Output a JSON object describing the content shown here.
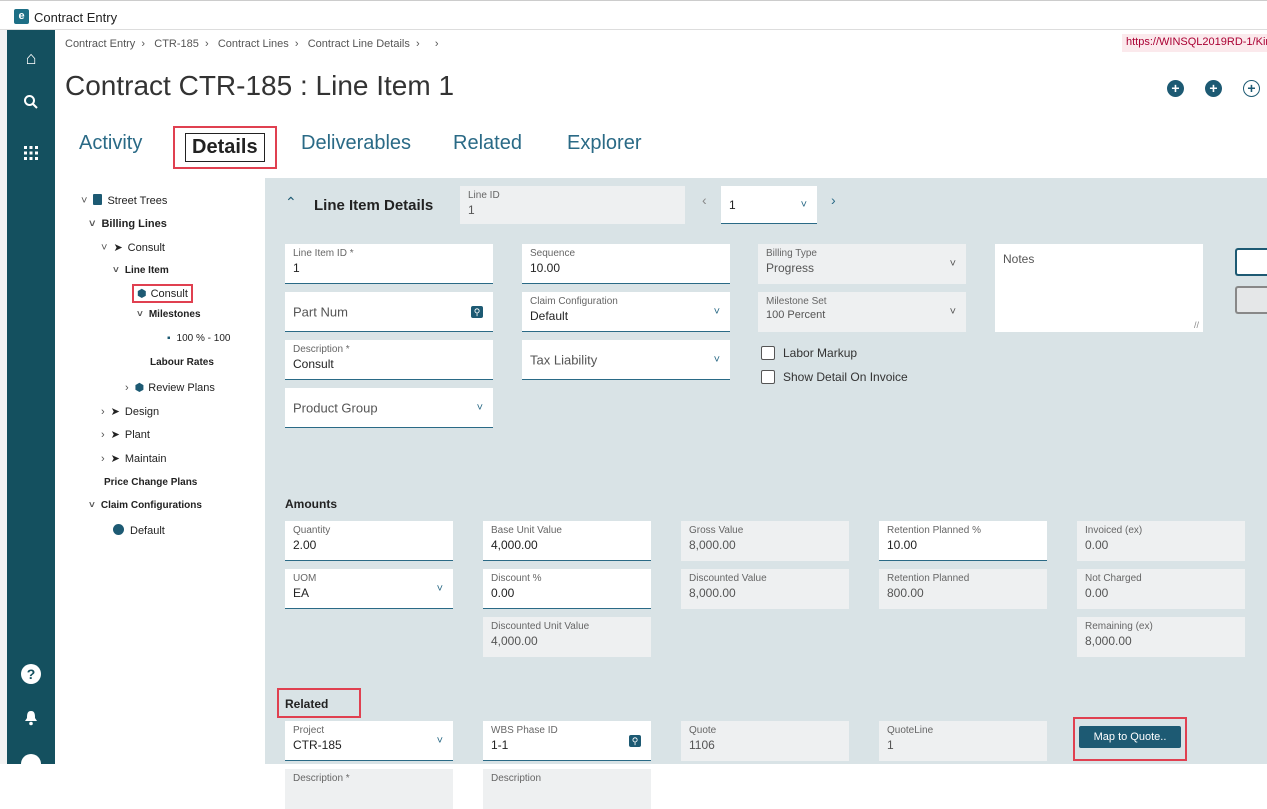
{
  "window": {
    "title": "Contract Entry"
  },
  "breadcrumb": [
    "Contract Entry",
    "CTR-185",
    "Contract Lines",
    "Contract Line Details",
    ""
  ],
  "url": "https://WINSQL2019RD-1/Kin",
  "page_title": "Contract CTR-185 : Line Item 1",
  "tabs": [
    "Activity",
    "Details",
    "Deliverables",
    "Related",
    "Explorer"
  ],
  "tree": {
    "street_trees": "Street Trees",
    "billing_lines": "Billing Lines",
    "consult": "Consult",
    "line_item": "Line Item",
    "consult_node": "Consult",
    "milestones": "Milestones",
    "milestone_100": "100 % - 100",
    "labour_rates": "Labour Rates",
    "review_plans": "Review Plans",
    "design": "Design",
    "plant": "Plant",
    "maintain": "Maintain",
    "price_change_plans": "Price Change Plans",
    "claim_configurations": "Claim Configurations",
    "default": "Default"
  },
  "header": {
    "section": "Line Item Details",
    "line_id_label": "Line ID",
    "line_id_value": "1",
    "pager_value": "1"
  },
  "fields": {
    "line_item_id": {
      "label": "Line Item ID *",
      "value": "1"
    },
    "sequence": {
      "label": "Sequence",
      "value": "10.00"
    },
    "billing_type": {
      "label": "Billing Type",
      "value": "Progress"
    },
    "notes": {
      "label": "Notes"
    },
    "part_num": {
      "placeholder": "Part Num"
    },
    "claim_configuration": {
      "label": "Claim Configuration",
      "value": "Default"
    },
    "milestone_set": {
      "label": "Milestone Set",
      "value": "100 Percent"
    },
    "description": {
      "label": "Description *",
      "value": "Consult"
    },
    "tax_liability": {
      "placeholder": "Tax Liability"
    },
    "labor_markup": "Labor Markup",
    "show_detail": "Show Detail On Invoice",
    "product_group": {
      "placeholder": "Product Group"
    }
  },
  "amounts": {
    "title": "Amounts",
    "quantity": {
      "label": "Quantity",
      "value": "2.00"
    },
    "base_unit_value": {
      "label": "Base Unit Value",
      "value": "4,000.00"
    },
    "gross_value": {
      "label": "Gross Value",
      "value": "8,000.00"
    },
    "retention_planned_pct": {
      "label": "Retention Planned %",
      "value": "10.00"
    },
    "invoiced_ex": {
      "label": "Invoiced (ex)",
      "value": "0.00"
    },
    "uom": {
      "label": "UOM",
      "value": "EA"
    },
    "discount_pct": {
      "label": "Discount %",
      "value": "0.00"
    },
    "discounted_value": {
      "label": "Discounted Value",
      "value": "8,000.00"
    },
    "retention_planned": {
      "label": "Retention Planned",
      "value": "800.00"
    },
    "not_charged": {
      "label": "Not Charged",
      "value": "0.00"
    },
    "discounted_unit_value": {
      "label": "Discounted Unit Value",
      "value": "4,000.00"
    },
    "remaining_ex": {
      "label": "Remaining (ex)",
      "value": "8,000.00"
    }
  },
  "related": {
    "title": "Related",
    "project": {
      "label": "Project",
      "value": "CTR-185"
    },
    "wbs_phase_id": {
      "label": "WBS Phase ID",
      "value": "1-1"
    },
    "quote": {
      "label": "Quote",
      "value": "1106"
    },
    "quote_line": {
      "label": "QuoteLine",
      "value": "1"
    },
    "map_button": "Map to Quote..",
    "description_req": {
      "label": "Description *"
    },
    "description": {
      "label": "Description"
    }
  },
  "colors": {
    "nav": "#14505f",
    "accent": "#2a6a86",
    "highlight": "#e04050",
    "panel": "#d9e3e6"
  }
}
